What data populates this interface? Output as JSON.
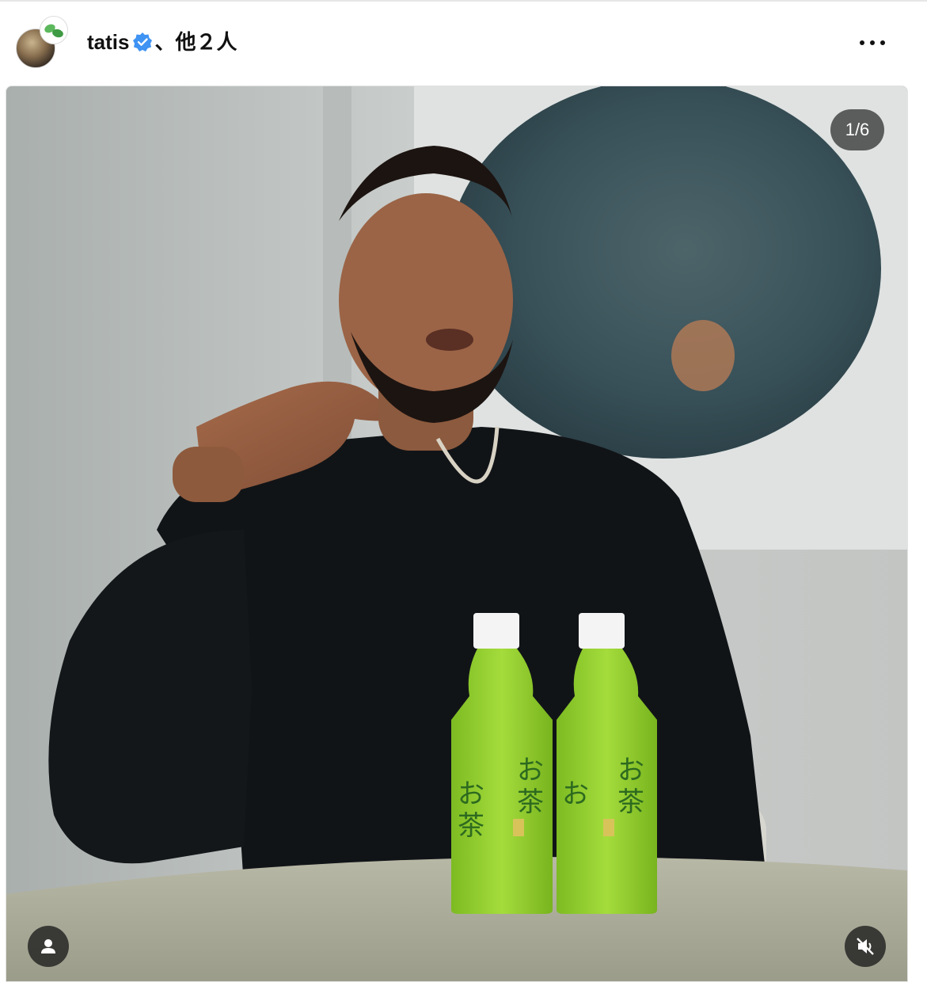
{
  "post_header": {
    "username": "tatis",
    "others": "、他２人",
    "verified": true,
    "more_icon": "more-horizontal-icon"
  },
  "media": {
    "carousel_counter": "1/6",
    "tag_icon": "user-tag-icon",
    "mute_icon": "speaker-muted-icon",
    "accent_bottle_color": "#8ecb2f"
  }
}
